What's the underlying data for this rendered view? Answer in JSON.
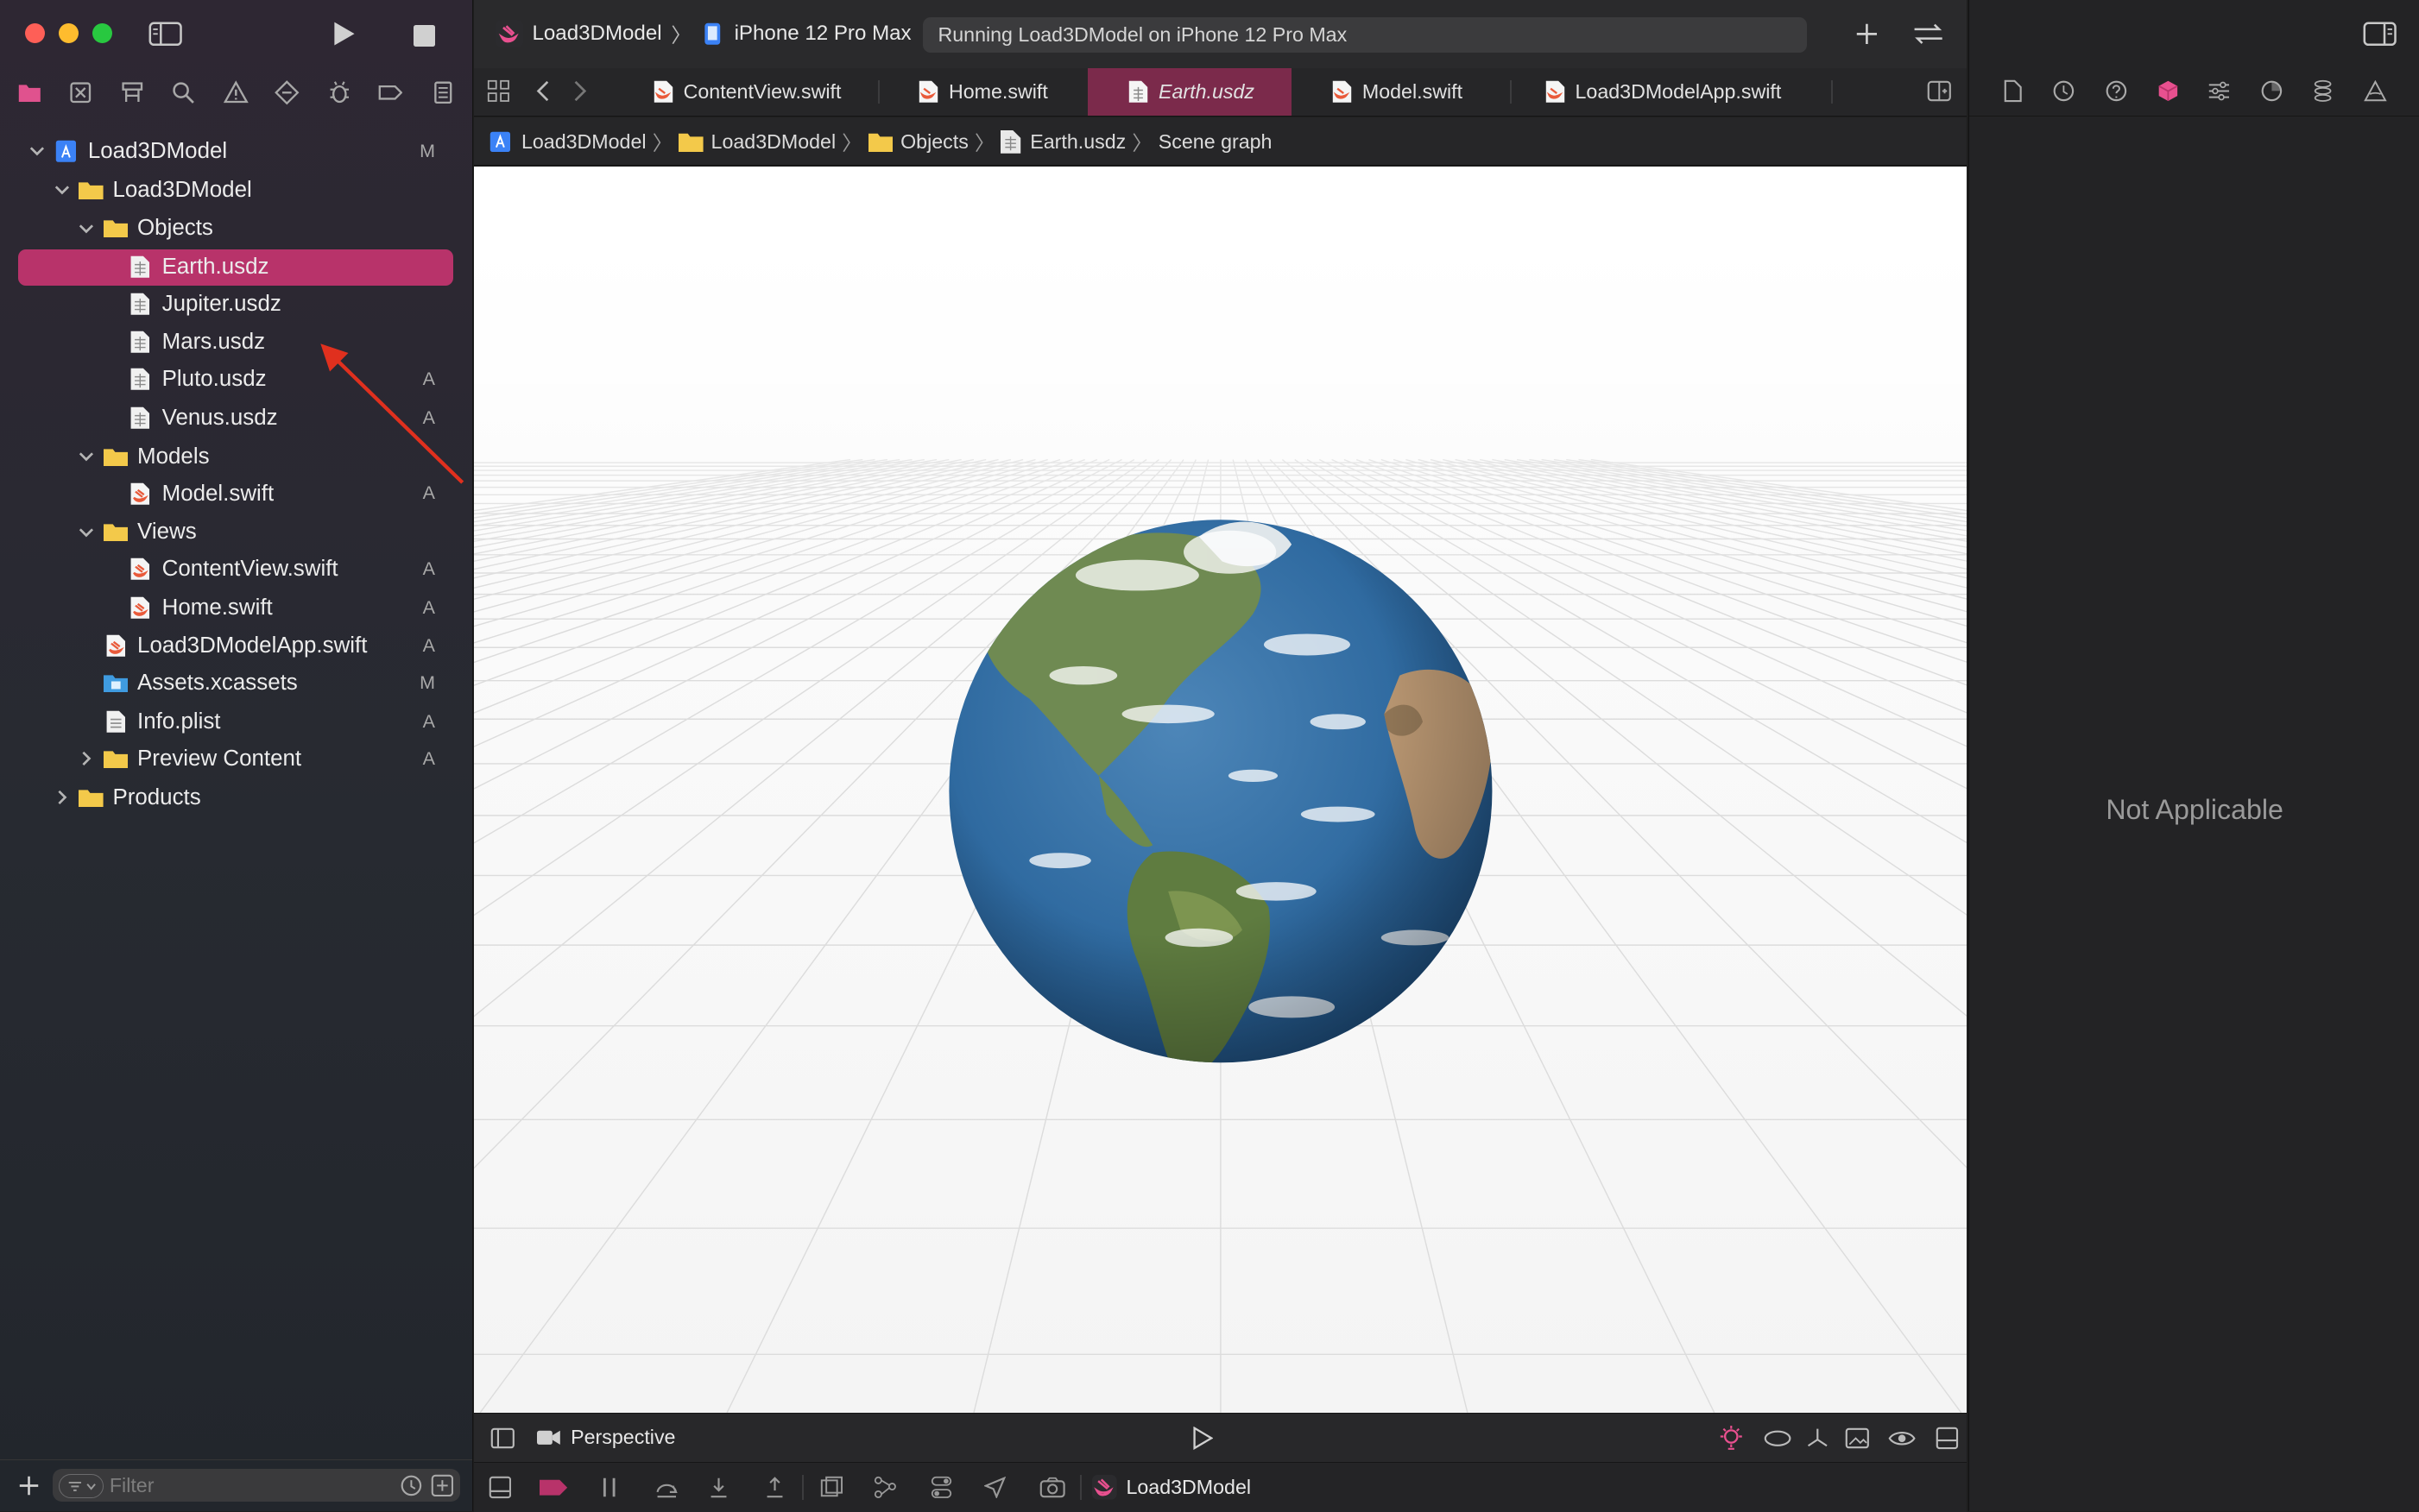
{
  "window": {
    "scheme": "Load3DModel",
    "device": "iPhone 12 Pro Max",
    "status": "Running Load3DModel on iPhone 12 Pro Max"
  },
  "tabs": [
    {
      "label": "ContentView.swift"
    },
    {
      "label": "Home.swift"
    },
    {
      "label": "Earth.usdz"
    },
    {
      "label": "Model.swift"
    },
    {
      "label": "Load3DModelApp.swift"
    }
  ],
  "breadcrumb": [
    "Load3DModel",
    "Load3DModel",
    "Objects",
    "Earth.usdz",
    "Scene graph"
  ],
  "navigator": {
    "items": [
      {
        "label": "Load3DModel",
        "badge": "M"
      },
      {
        "label": "Load3DModel",
        "badge": ""
      },
      {
        "label": "Objects",
        "badge": ""
      },
      {
        "label": "Earth.usdz",
        "badge": ""
      },
      {
        "label": "Jupiter.usdz",
        "badge": ""
      },
      {
        "label": "Mars.usdz",
        "badge": ""
      },
      {
        "label": "Pluto.usdz",
        "badge": "A"
      },
      {
        "label": "Venus.usdz",
        "badge": "A"
      },
      {
        "label": "Models",
        "badge": ""
      },
      {
        "label": "Model.swift",
        "badge": "A"
      },
      {
        "label": "Views",
        "badge": ""
      },
      {
        "label": "ContentView.swift",
        "badge": "A"
      },
      {
        "label": "Home.swift",
        "badge": "A"
      },
      {
        "label": "Load3DModelApp.swift",
        "badge": "A"
      },
      {
        "label": "Assets.xcassets",
        "badge": "M"
      },
      {
        "label": "Info.plist",
        "badge": "A"
      },
      {
        "label": "Preview Content",
        "badge": "A"
      },
      {
        "label": "Products",
        "badge": ""
      }
    ],
    "filter_placeholder": "Filter"
  },
  "scene": {
    "camera_label": "Perspective"
  },
  "debug": {
    "target": "Load3DModel"
  },
  "inspector": {
    "empty_text": "Not Applicable"
  },
  "colors": {
    "accent": "#b8336a",
    "active_tab": "#7b2a4b",
    "folder": "#f3c94a",
    "swift": "#e95a3a",
    "annotation_arrow": "#e0301e"
  }
}
